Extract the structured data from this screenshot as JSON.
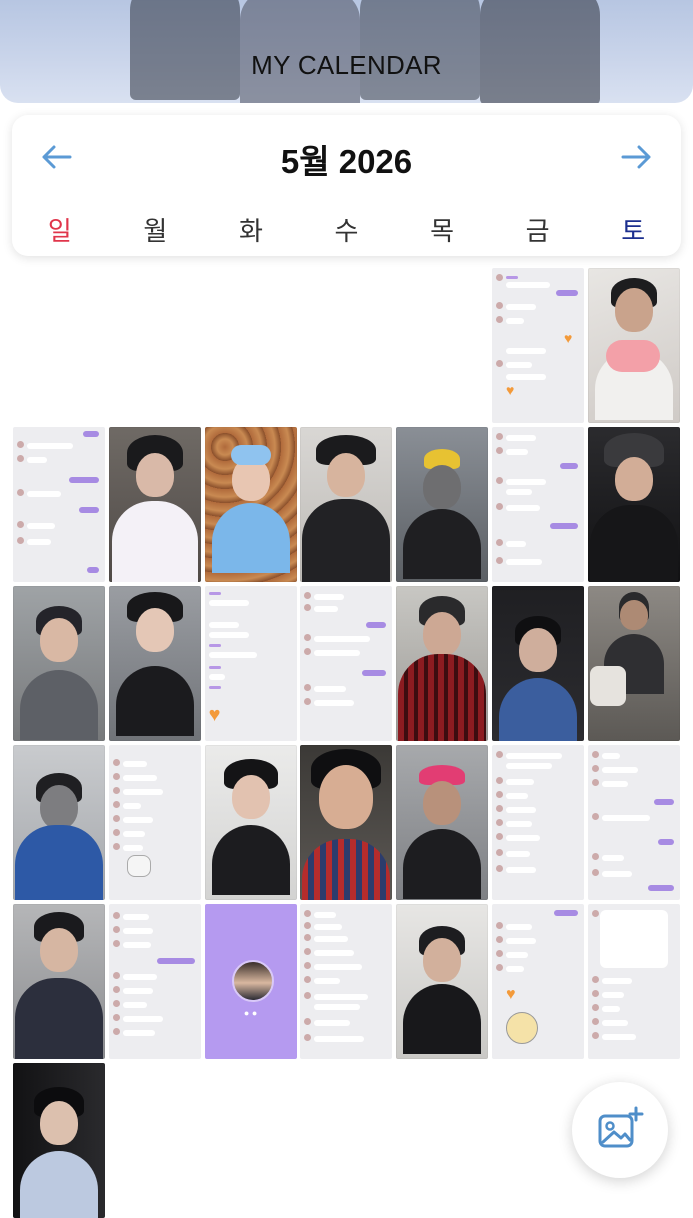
{
  "header": {
    "title": "MY CALENDAR"
  },
  "calendar": {
    "month_title": "5월 2026",
    "prev_icon": "arrow-left-icon",
    "next_icon": "arrow-right-icon",
    "weekdays": [
      "일",
      "월",
      "화",
      "수",
      "목",
      "금",
      "토"
    ],
    "colors": {
      "sunday": "#e0354b",
      "saturday": "#1c2f8f",
      "arrow": "#5b9ad5",
      "accent": "#b59af0"
    },
    "cells": [
      {
        "day": "empty"
      },
      {
        "day": "empty"
      },
      {
        "day": "empty"
      },
      {
        "day": "empty"
      },
      {
        "day": "empty"
      },
      {
        "type": "chat"
      },
      {
        "type": "photo"
      },
      {
        "type": "chat"
      },
      {
        "type": "photo"
      },
      {
        "type": "photo"
      },
      {
        "type": "photo"
      },
      {
        "type": "photo"
      },
      {
        "type": "chat"
      },
      {
        "type": "photo"
      },
      {
        "type": "photo"
      },
      {
        "type": "photo"
      },
      {
        "type": "chat"
      },
      {
        "type": "chat"
      },
      {
        "type": "photo"
      },
      {
        "type": "photo"
      },
      {
        "type": "photo"
      },
      {
        "type": "photo"
      },
      {
        "type": "chat"
      },
      {
        "type": "photo"
      },
      {
        "type": "photo"
      },
      {
        "type": "photo"
      },
      {
        "type": "chat"
      },
      {
        "type": "chat"
      },
      {
        "type": "photo"
      },
      {
        "type": "chat"
      },
      {
        "type": "profile"
      },
      {
        "type": "chat"
      },
      {
        "type": "photo"
      },
      {
        "type": "chat"
      },
      {
        "type": "chat"
      },
      {
        "type": "photo"
      }
    ]
  },
  "fab": {
    "icon": "add-photo-icon"
  }
}
